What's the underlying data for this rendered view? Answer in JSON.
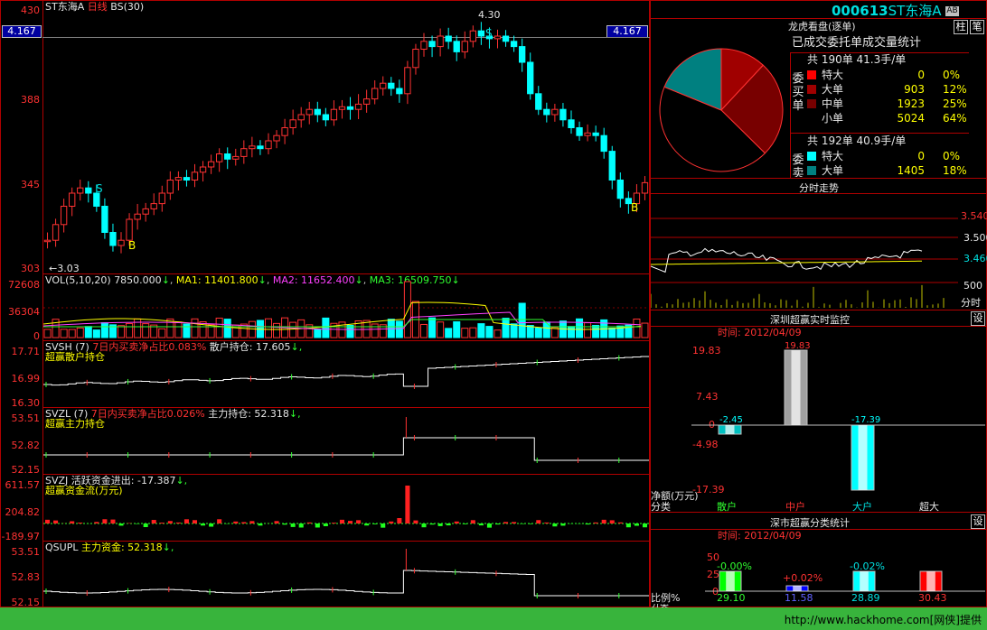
{
  "main_chart": {
    "title": "ST东海A",
    "period": "日线",
    "indicator": "BS(30)",
    "price_top": "430",
    "price_levels": [
      "388",
      "345",
      "303"
    ],
    "cursor_price": "4.167",
    "cursor_price_right": "4.167",
    "high_label": "4.30",
    "low_label": "3.03",
    "signal_sell": "S",
    "signal_buy": "B"
  },
  "vol": {
    "label": "VOL(5,10,20)",
    "value": "7850.000",
    "ma1": "MA1: 11401.800",
    "ma2": "MA2: 11652.400",
    "ma3": "MA3: 16509.750",
    "arrow": "↓",
    "levels": [
      "72608",
      "36304",
      "0"
    ]
  },
  "svsh": {
    "label": "SVSH (7)",
    "desc": "7日内买卖净占比",
    "pct": "0.083%",
    "hold": "散户持仓: 17.605",
    "arrow": "↓,",
    "sub": "超赢散户持仓",
    "levels": [
      "17.71",
      "16.99",
      "16.30"
    ]
  },
  "svzl": {
    "label": "SVZL (7)",
    "desc": "7日内买卖净占比",
    "pct": "0.026%",
    "hold": "主力持仓: 52.318",
    "arrow": "↓,",
    "sub": "超赢主力持仓",
    "levels": [
      "53.51",
      "52.82",
      "52.15"
    ]
  },
  "svzj": {
    "label": "SVZJ",
    "desc": "活跃资金进出: -17.387",
    "arrow": "↓,",
    "sub": "超赢资金流(万元)",
    "levels": [
      "611.57",
      "204.82",
      "-189.97"
    ]
  },
  "qsupl": {
    "label": "QSUPL",
    "desc": "主力资金: 52.318",
    "arrow": "↓,",
    "levels": [
      "53.51",
      "52.83",
      "52.15"
    ]
  },
  "header": {
    "code": "000613",
    "name": "ST东海A",
    "badge": "AB",
    "btn1": "柱",
    "btn2": "笔"
  },
  "longhu": {
    "title": "龙虎看盘(逐单)",
    "subtitle": "已成交委托单成交量统计",
    "buy_side": "委买单",
    "sell_side": "委卖单",
    "buy_total": "共 190单 41.3手/单",
    "sell_total": "共 192单 40.9手/单",
    "buy_rows": [
      {
        "name": "特大",
        "val": "0",
        "pct": "0%",
        "color": "#ff0000"
      },
      {
        "name": "大单",
        "val": "903",
        "pct": "12%",
        "color": "#a00000"
      },
      {
        "name": "中单",
        "val": "1923",
        "pct": "25%",
        "color": "#780000"
      },
      {
        "name": "小单",
        "val": "5024",
        "pct": "64%",
        "color": ""
      }
    ],
    "sell_rows": [
      {
        "name": "特大",
        "val": "0",
        "pct": "0%",
        "color": "#00ffff"
      },
      {
        "name": "大单",
        "val": "1405",
        "pct": "18%",
        "color": "#008080"
      }
    ],
    "pie_colors": [
      "#780000",
      "#a00000",
      "#008080"
    ]
  },
  "minute": {
    "title": "分时走势",
    "levels": [
      "3.540",
      "3.500",
      "3.460",
      "500"
    ],
    "time_label": "分时"
  },
  "realtime": {
    "title": "深圳超赢实时监控",
    "set_btn": "设",
    "time": "时间: 2012/04/09",
    "levels": [
      "19.83",
      "7.43",
      "0",
      "-4.98",
      "-17.39"
    ],
    "bar_values": [
      "-2.45",
      "19.83",
      "-17.39"
    ],
    "ylabel": "净额(万元)",
    "xlabel": "分类",
    "categories": [
      "散户",
      "中户",
      "大户",
      "超大"
    ]
  },
  "classify": {
    "title": "深市超赢分类统计",
    "set_btn": "设",
    "time": "时间: 2012/04/09",
    "levels": [
      "50",
      "25",
      "0"
    ],
    "top_values": [
      "-0.00%",
      "+0.02%",
      "-0.02%"
    ],
    "bottom_values": [
      "29.10",
      "11.58",
      "28.89",
      "30.43"
    ],
    "ylabel": "比例%",
    "xlabel": "分类"
  },
  "footer": {
    "text": "http://www.hackhome.com[网侠]提供"
  }
}
